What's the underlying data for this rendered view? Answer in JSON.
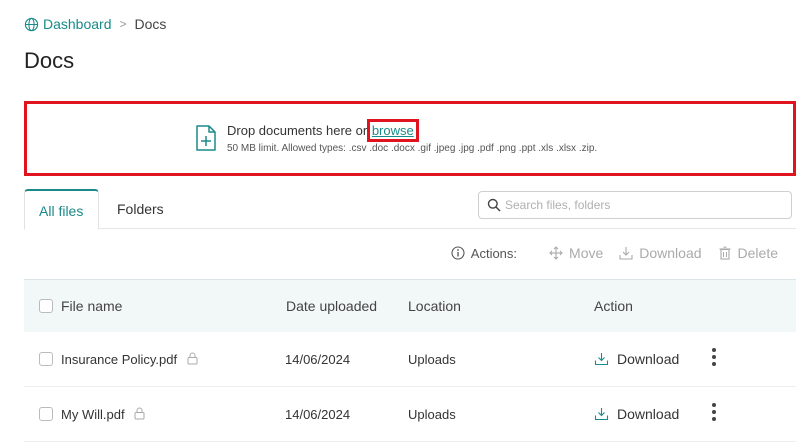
{
  "breadcrumb": {
    "home": "Dashboard",
    "separator": ">",
    "current": "Docs"
  },
  "page": {
    "title": "Docs"
  },
  "dropzone": {
    "text": "Drop documents here or",
    "browse": "browse",
    "limits": "50 MB limit. Allowed types: .csv .doc .docx .gif .jpeg .jpg .pdf .png .ppt .xls .xlsx .zip."
  },
  "tabs": {
    "all": "All files",
    "folders": "Folders"
  },
  "search": {
    "placeholder": "Search files, folders",
    "value": ""
  },
  "actions": {
    "label": "Actions:",
    "move": "Move",
    "download": "Download",
    "delete": "Delete"
  },
  "table": {
    "headers": {
      "name": "File name",
      "date": "Date uploaded",
      "location": "Location",
      "action": "Action"
    },
    "rows": [
      {
        "name": "Insurance Policy.pdf",
        "date": "14/06/2024",
        "location": "Uploads",
        "action": "Download"
      },
      {
        "name": "My Will.pdf",
        "date": "14/06/2024",
        "location": "Uploads",
        "action": "Download"
      }
    ]
  },
  "colors": {
    "accent": "#1a8a8a",
    "highlight": "#e0141f",
    "header_bg": "#f2f7f8"
  }
}
